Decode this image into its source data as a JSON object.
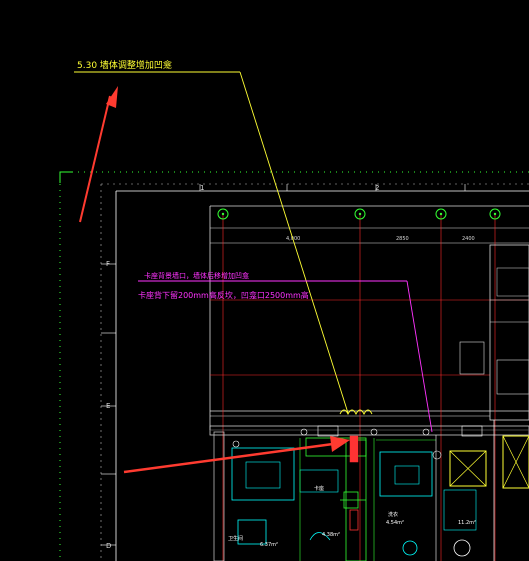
{
  "drawing": {
    "background": "#000000",
    "annotations": {
      "top_note": "5.30 墙体调整增加凹龛",
      "pink_line_1": "卡座背景墙口，墙体后移增加凹龛",
      "pink_line_2": "卡座背下留200mm高反坎，凹龛口2500mm高"
    },
    "grid_columns": [
      "1",
      "2"
    ],
    "grid_rows": [
      "F",
      "E",
      "D"
    ],
    "dimensions": [
      "4,000",
      "2850",
      "2400"
    ],
    "room_labels": [
      "卫生间",
      "6.37m²",
      "卡座",
      "4.38m²",
      "洗衣",
      "4.54m²",
      "11.2m²"
    ],
    "colors": {
      "yellow": "#ffff33",
      "magenta": "#ff33ff",
      "red_arrow": "#ff3b30",
      "green": "#33ff33",
      "cyan": "#00ffff",
      "grid_red": "#ff2a2a",
      "white": "#ffffff"
    }
  }
}
